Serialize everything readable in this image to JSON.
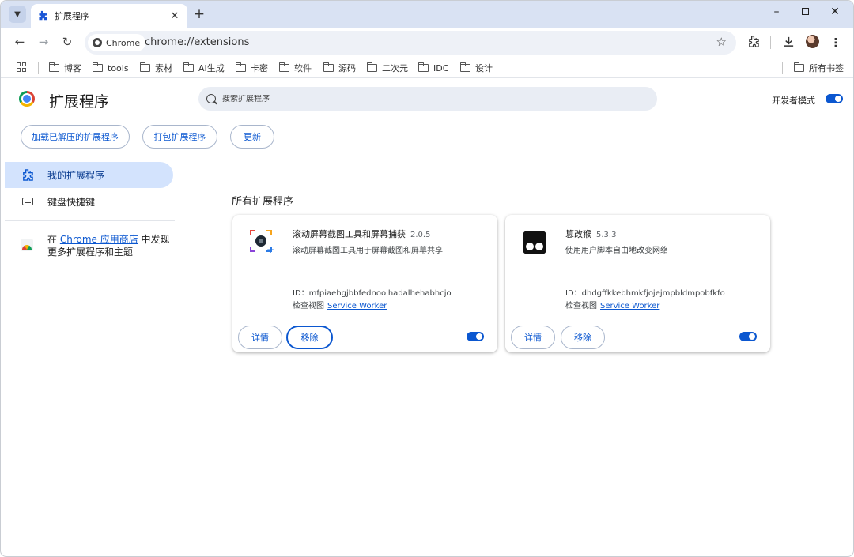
{
  "tab": {
    "title": "扩展程序",
    "favicon": "puzzle-icon"
  },
  "toolbar": {
    "site_chip": "Chrome",
    "url": "chrome://extensions"
  },
  "bookmarks": {
    "items": [
      "博客",
      "tools",
      "素材",
      "AI生成",
      "卡密",
      "软件",
      "源码",
      "二次元",
      "IDC",
      "设计"
    ],
    "all_bookmarks": "所有书签"
  },
  "header": {
    "title": "扩展程序",
    "search_placeholder": "搜索扩展程序",
    "dev_mode_label": "开发者模式",
    "dev_mode_on": true
  },
  "actions": {
    "load_unpacked": "加载已解压的扩展程序",
    "pack": "打包扩展程序",
    "update": "更新"
  },
  "sidebar": {
    "my_extensions": "我的扩展程序",
    "shortcuts": "键盘快捷键",
    "webstore_prefix": "在 ",
    "webstore_link": "Chrome 应用商店",
    "webstore_suffix": " 中发现更多扩展程序和主题"
  },
  "main": {
    "section_title": "所有扩展程序",
    "extensions": [
      {
        "name": "滚动屏幕截图工具和屏幕捕获",
        "version": "2.0.5",
        "description": "滚动屏幕截图工具用于屏幕截图和屏幕共享",
        "id_text": "ID：mfpiaehgjbbfednooihadalhehabhcjo",
        "inspect_label": "检查视图",
        "inspect_link": "Service Worker",
        "details_label": "详情",
        "remove_label": "移除",
        "enabled": true
      },
      {
        "name": "篡改猴",
        "version": "5.3.3",
        "description": "使用用户脚本自由地改变网络",
        "id_text": "ID：dhdgffkkebhmkfjojejmpbldmpobfkfo",
        "inspect_label": "检查视图",
        "inspect_link": "Service Worker",
        "details_label": "详情",
        "remove_label": "移除",
        "enabled": true
      }
    ]
  },
  "colors": {
    "accent": "#0b57d0",
    "tabstrip": "#d9e2f3",
    "sidebar_active": "#d3e3fd"
  }
}
